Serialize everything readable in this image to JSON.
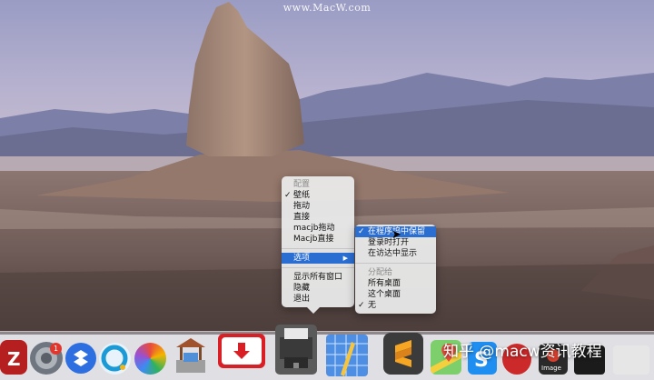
{
  "watermark_top": "www.MacW.com",
  "main_menu": {
    "header": "配置",
    "items": [
      "壁纸",
      "拖动",
      "直接",
      "macjb拖动",
      "Macjb直接"
    ],
    "checked_item": "壁纸",
    "options_label": "选项",
    "bottom_items": [
      "显示所有窗口",
      "隐藏",
      "退出"
    ]
  },
  "sub_menu": {
    "items": [
      "在程序坞中保留",
      "登录时打开",
      "在访达中显示"
    ],
    "checked_item": "在程序坞中保留",
    "assign_header": "分配给",
    "assign_items": [
      "所有桌面",
      "这个桌面",
      "无"
    ],
    "assign_checked": "无"
  },
  "dock": {
    "badge_count": "1",
    "watermark": "知乎 @macw资讯教程",
    "icons": [
      "filezilla-icon",
      "system-preferences-icon",
      "dropbox-icon",
      "qq-browser-icon",
      "pinwheel-icon",
      "wishing-well-icon",
      "download-app-icon",
      "printer-icon",
      "xcode-blueprint-icon",
      "sublime-text-icon",
      "maps-icon",
      "s-app-icon",
      "red-app-icon",
      "image-app-icon",
      "window-app-icon"
    ]
  },
  "colors": {
    "menu_highlight": "#2a6ed2",
    "badge": "#e1362d"
  }
}
